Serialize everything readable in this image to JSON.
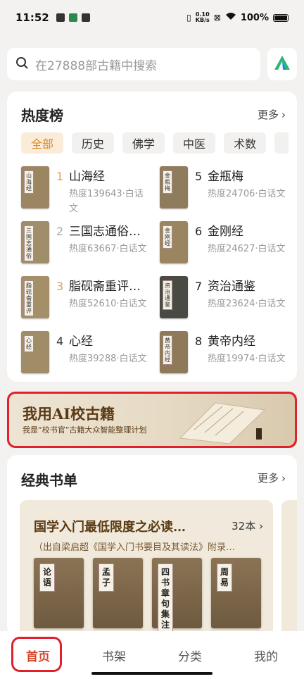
{
  "status_bar": {
    "time": "11:52",
    "net_speed_value": "0.10",
    "net_speed_unit": "KB/s",
    "battery": "100%"
  },
  "search": {
    "placeholder": "在27888部古籍中搜索"
  },
  "hot": {
    "title": "热度榜",
    "more": "更多",
    "chips": [
      {
        "label": "全部",
        "active": true
      },
      {
        "label": "历史",
        "active": false
      },
      {
        "label": "佛学",
        "active": false
      },
      {
        "label": "中医",
        "active": false
      },
      {
        "label": "术数",
        "active": false
      }
    ],
    "items": [
      {
        "rank": "1",
        "title": "山海经",
        "meta": "热度139643·白话文",
        "cover_label": "山海经"
      },
      {
        "rank": "5",
        "title": "金瓶梅",
        "meta": "热度24706·白话文",
        "cover_label": "金瓶梅"
      },
      {
        "rank": "2",
        "title": "三国志通俗…",
        "meta": "热度63667·白话文",
        "cover_label": "三国志通俗"
      },
      {
        "rank": "6",
        "title": "金刚经",
        "meta": "热度24627·白话文",
        "cover_label": "金刚经"
      },
      {
        "rank": "3",
        "title": "脂砚斋重评…",
        "meta": "热度52610·白话文",
        "cover_label": "脂砚斋重评"
      },
      {
        "rank": "7",
        "title": "资治通鉴",
        "meta": "热度23624·白话文",
        "cover_label": "资治通鉴"
      },
      {
        "rank": "4",
        "title": "心经",
        "meta": "热度39288·白话文",
        "cover_label": "心经"
      },
      {
        "rank": "8",
        "title": "黄帝内经",
        "meta": "热度19974·白话文",
        "cover_label": "黄帝内经"
      }
    ]
  },
  "banner": {
    "title": "我用AI校古籍",
    "subtitle": "我是“校书官”古籍大众智能整理计划"
  },
  "classic": {
    "title": "经典书单",
    "more": "更多",
    "list": {
      "title": "国学入门最低限度之必读…",
      "count": "32本",
      "subtitle": "（出自梁启超《国学入门书要目及其读法》附录…",
      "books": [
        {
          "label": "论语"
        },
        {
          "label": "孟子"
        },
        {
          "label": "四书章句集注"
        },
        {
          "label": "周易"
        }
      ]
    }
  },
  "tabs": [
    {
      "label": "首页",
      "active": true
    },
    {
      "label": "书架",
      "active": false
    },
    {
      "label": "分类",
      "active": false
    },
    {
      "label": "我的",
      "active": false
    }
  ],
  "colors": {
    "accent": "#d9432a",
    "chip_active_bg": "#fbecd9",
    "chip_active_text": "#d88a2a",
    "highlight": "#e0202a",
    "rank_top": "#d9a25a",
    "rank_normal": "#999999"
  }
}
